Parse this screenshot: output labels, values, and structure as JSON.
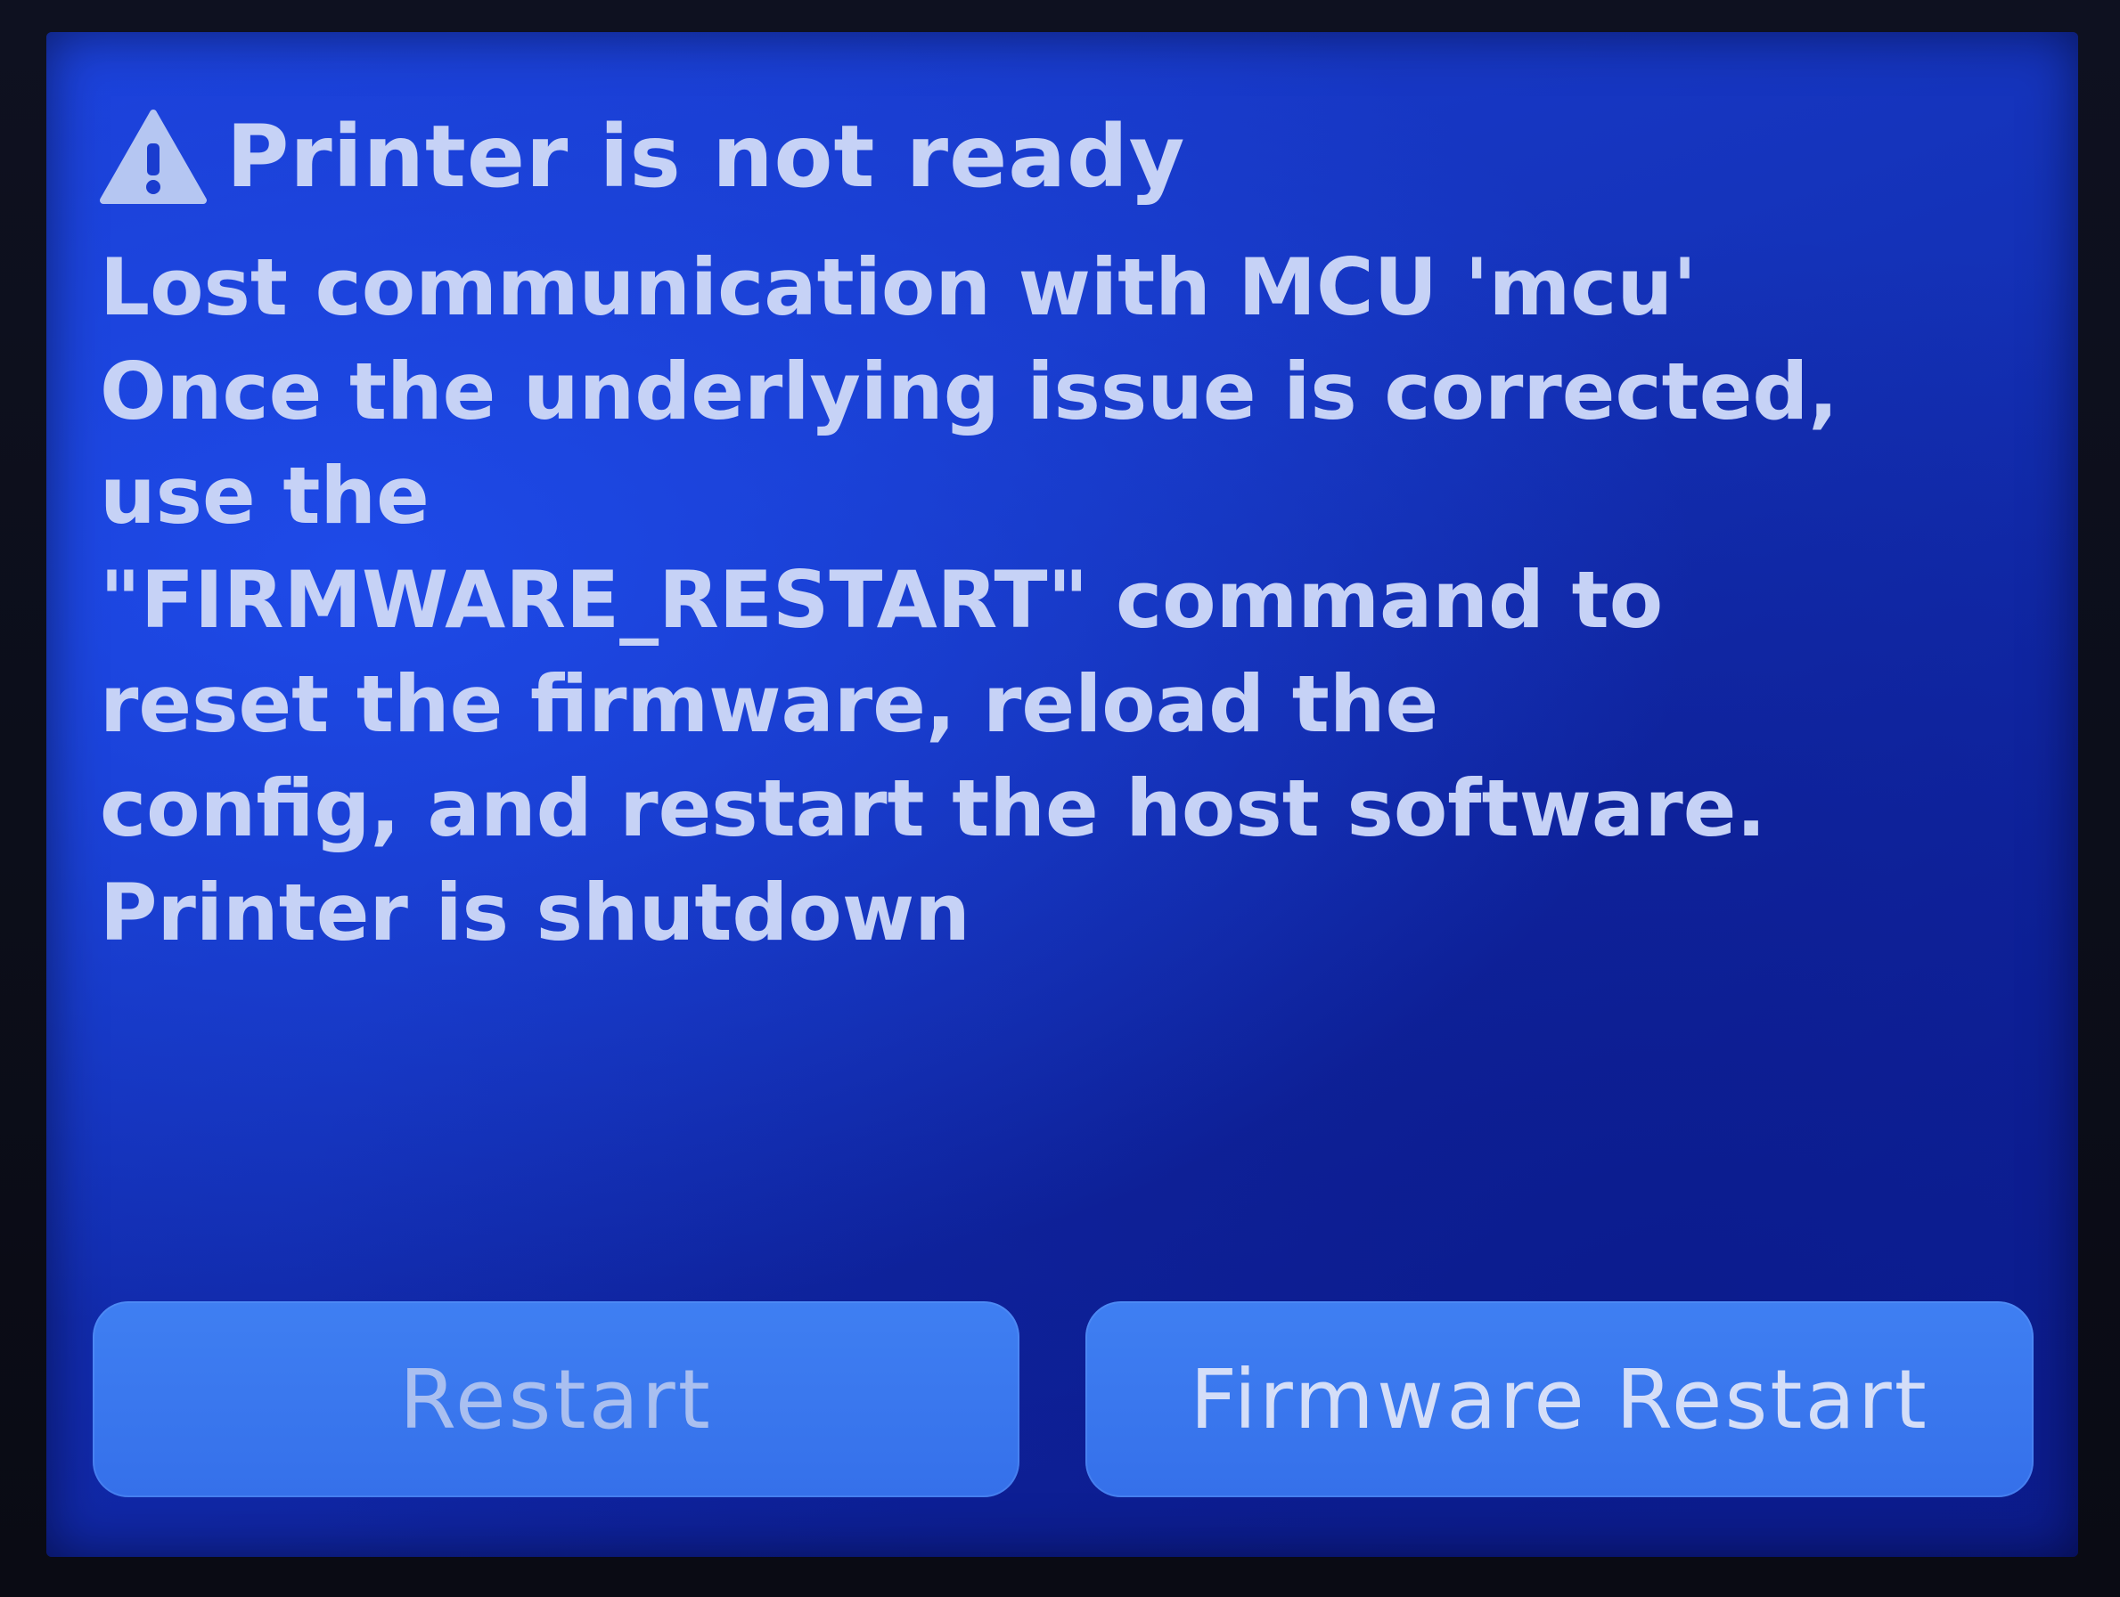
{
  "dialog": {
    "title": "Printer is not ready",
    "icon": "warning-icon",
    "message_lines": [
      "Lost communication with MCU 'mcu'",
      "Once the underlying issue is corrected,",
      "use the",
      "\"FIRMWARE_RESTART\" command to",
      "reset the firmware, reload the",
      "config, and restart the host software.",
      "Printer is shutdown"
    ]
  },
  "buttons": {
    "restart_label": "Restart",
    "firmware_restart_label": "Firmware Restart"
  },
  "colors": {
    "background": "#1636c4",
    "text": "#c6d2f6",
    "button": "#3a78f0"
  }
}
